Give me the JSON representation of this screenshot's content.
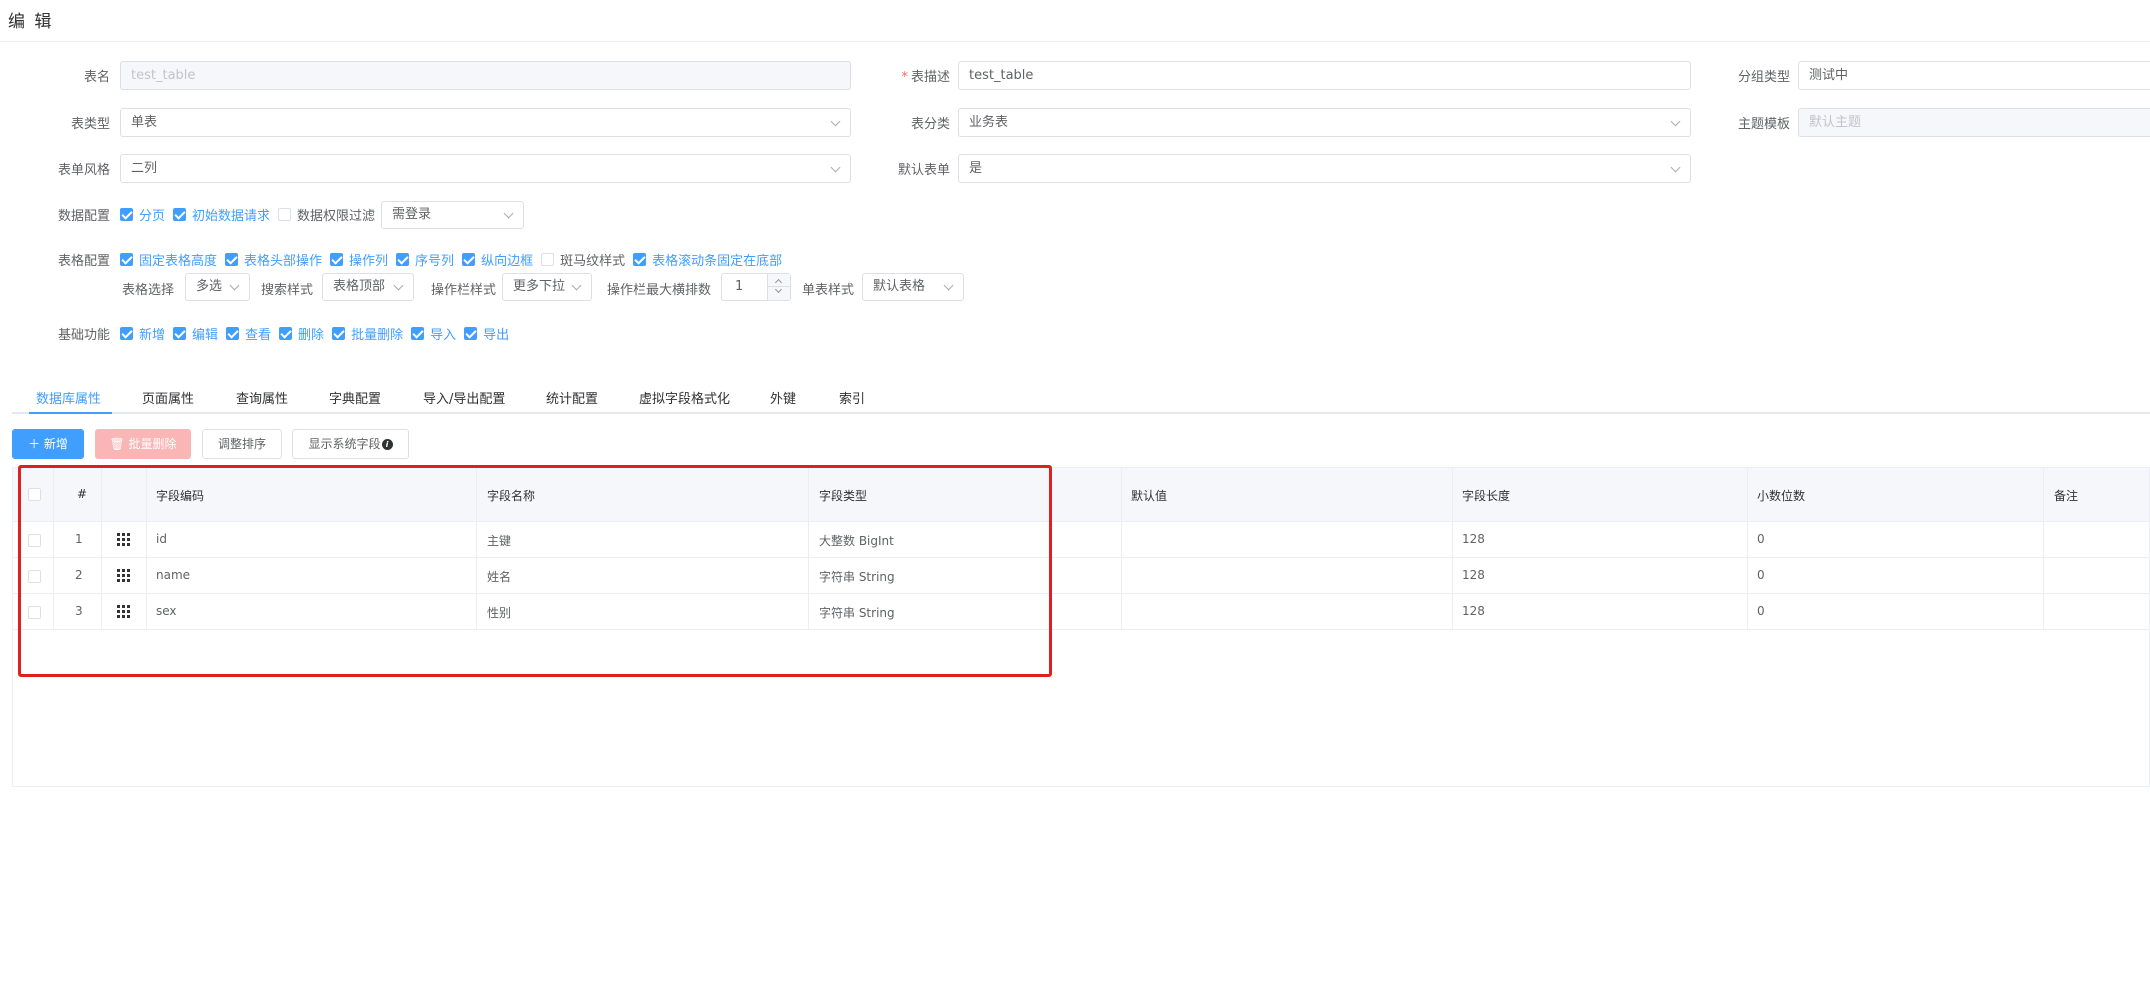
{
  "dialog": {
    "title": "编 辑"
  },
  "form": {
    "table_name": {
      "label": "表名",
      "value": "test_table"
    },
    "table_desc": {
      "label": "表描述",
      "value": "test_table"
    },
    "group_type": {
      "label": "分组类型",
      "value": "测试中"
    },
    "table_type": {
      "label": "表类型",
      "value": "单表"
    },
    "table_category": {
      "label": "表分类",
      "value": "业务表"
    },
    "theme_template": {
      "label": "主题模板",
      "placeholder": "默认主题"
    },
    "form_style": {
      "label": "表单风格",
      "value": "二列"
    },
    "default_form": {
      "label": "默认表单",
      "value": "是"
    },
    "data_config": {
      "label": "数据配置",
      "items": [
        {
          "label": "分页",
          "checked": true
        },
        {
          "label": "初始数据请求",
          "checked": true
        },
        {
          "label": "数据权限过滤",
          "checked": false
        }
      ],
      "select_value": "需登录"
    },
    "table_config": {
      "label": "表格配置",
      "items": [
        {
          "label": "固定表格高度",
          "checked": true
        },
        {
          "label": "表格头部操作",
          "checked": true
        },
        {
          "label": "操作列",
          "checked": true
        },
        {
          "label": "序号列",
          "checked": true
        },
        {
          "label": "纵向边框",
          "checked": true
        },
        {
          "label": "斑马纹样式",
          "checked": false
        },
        {
          "label": "表格滚动条固定在底部",
          "checked": true
        }
      ],
      "select_label": "表格选择",
      "select_value": "多选",
      "search_style_label": "搜索样式",
      "search_style_value": "表格顶部",
      "action_style_label": "操作栏样式",
      "action_style_value": "更多下拉",
      "action_max_label": "操作栏最大横排数",
      "action_max_value": "1",
      "single_style_label": "单表样式",
      "single_style_value": "默认表格"
    },
    "basic_funcs": {
      "label": "基础功能",
      "items": [
        {
          "label": "新增",
          "checked": true
        },
        {
          "label": "编辑",
          "checked": true
        },
        {
          "label": "查看",
          "checked": true
        },
        {
          "label": "删除",
          "checked": true
        },
        {
          "label": "批量删除",
          "checked": true
        },
        {
          "label": "导入",
          "checked": true
        },
        {
          "label": "导出",
          "checked": true
        }
      ]
    }
  },
  "tabs": [
    "数据库属性",
    "页面属性",
    "查询属性",
    "字典配置",
    "导入/导出配置",
    "统计配置",
    "虚拟字段格式化",
    "外键",
    "索引"
  ],
  "toolbar": {
    "add_label": "新增",
    "batch_delete_label": "批量删除",
    "reorder_label": "调整排序",
    "show_sys_label": "显示系统字段"
  },
  "table": {
    "columns": [
      "#",
      "字段编码",
      "字段名称",
      "字段类型",
      "默认值",
      "字段长度",
      "小数位数",
      "备注"
    ],
    "rows": [
      {
        "index": "1",
        "code": "id",
        "name": "主键",
        "type": "大整数 BigInt",
        "default": "",
        "length": "128",
        "decimals": "0",
        "remark": ""
      },
      {
        "index": "2",
        "code": "name",
        "name": "姓名",
        "type": "字符串 String",
        "default": "",
        "length": "128",
        "decimals": "0",
        "remark": ""
      },
      {
        "index": "3",
        "code": "sex",
        "name": "性别",
        "type": "字符串 String",
        "default": "",
        "length": "128",
        "decimals": "0",
        "remark": ""
      }
    ]
  },
  "colors": {
    "primary": "#409eff",
    "danger_light": "#fab6b6",
    "highlight_border": "#e02020"
  }
}
